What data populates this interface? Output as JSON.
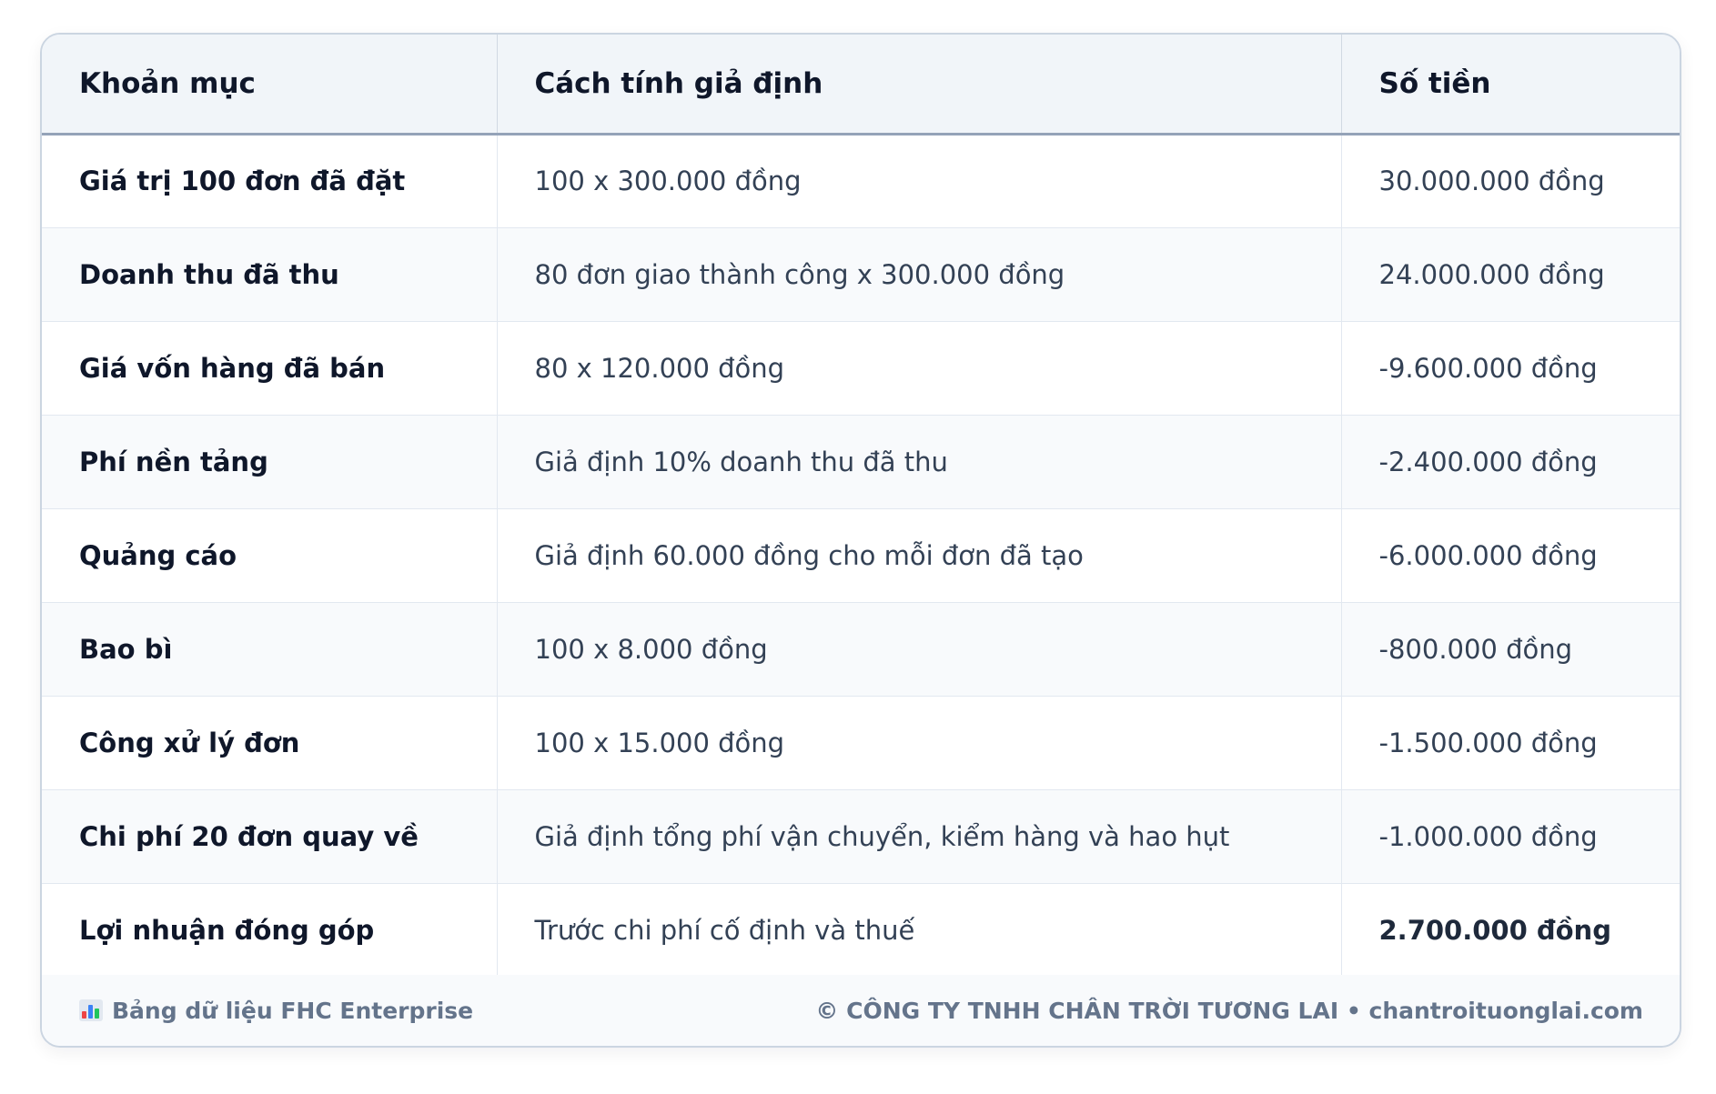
{
  "table": {
    "headers": {
      "item": "Khoản mục",
      "method": "Cách tính giả định",
      "amount": "Số tiền"
    },
    "rows": [
      {
        "item": "Giá trị 100 đơn đã đặt",
        "method": "100 x 300.000 đồng",
        "amount": "30.000.000 đồng"
      },
      {
        "item": "Doanh thu đã thu",
        "method": "80 đơn giao thành công x 300.000 đồng",
        "amount": "24.000.000 đồng"
      },
      {
        "item": "Giá vốn hàng đã bán",
        "method": "80 x 120.000 đồng",
        "amount": "-9.600.000 đồng"
      },
      {
        "item": "Phí nền tảng",
        "method": "Giả định 10% doanh thu đã thu",
        "amount": "-2.400.000 đồng"
      },
      {
        "item": "Quảng cáo",
        "method": "Giả định 60.000 đồng cho mỗi đơn đã tạo",
        "amount": "-6.000.000 đồng"
      },
      {
        "item": "Bao bì",
        "method": "100 x 8.000 đồng",
        "amount": "-800.000 đồng"
      },
      {
        "item": "Công xử lý đơn",
        "method": "100 x 15.000 đồng",
        "amount": "-1.500.000 đồng"
      },
      {
        "item": "Chi phí 20 đơn quay về",
        "method": "Giả định tổng phí vận chuyển, kiểm hàng và hao hụt",
        "amount": "-1.000.000 đồng"
      },
      {
        "item": "Lợi nhuận đóng góp",
        "method": "Trước chi phí cố định và thuế",
        "amount": "2.700.000 đồng"
      }
    ]
  },
  "footer": {
    "icon": "bar-chart-icon",
    "label": "Bảng dữ liệu FHC Enterprise",
    "copyright": "© CÔNG TY TNHH CHÂN TRỜI TƯƠNG LAI • chantroituonglai.com"
  }
}
